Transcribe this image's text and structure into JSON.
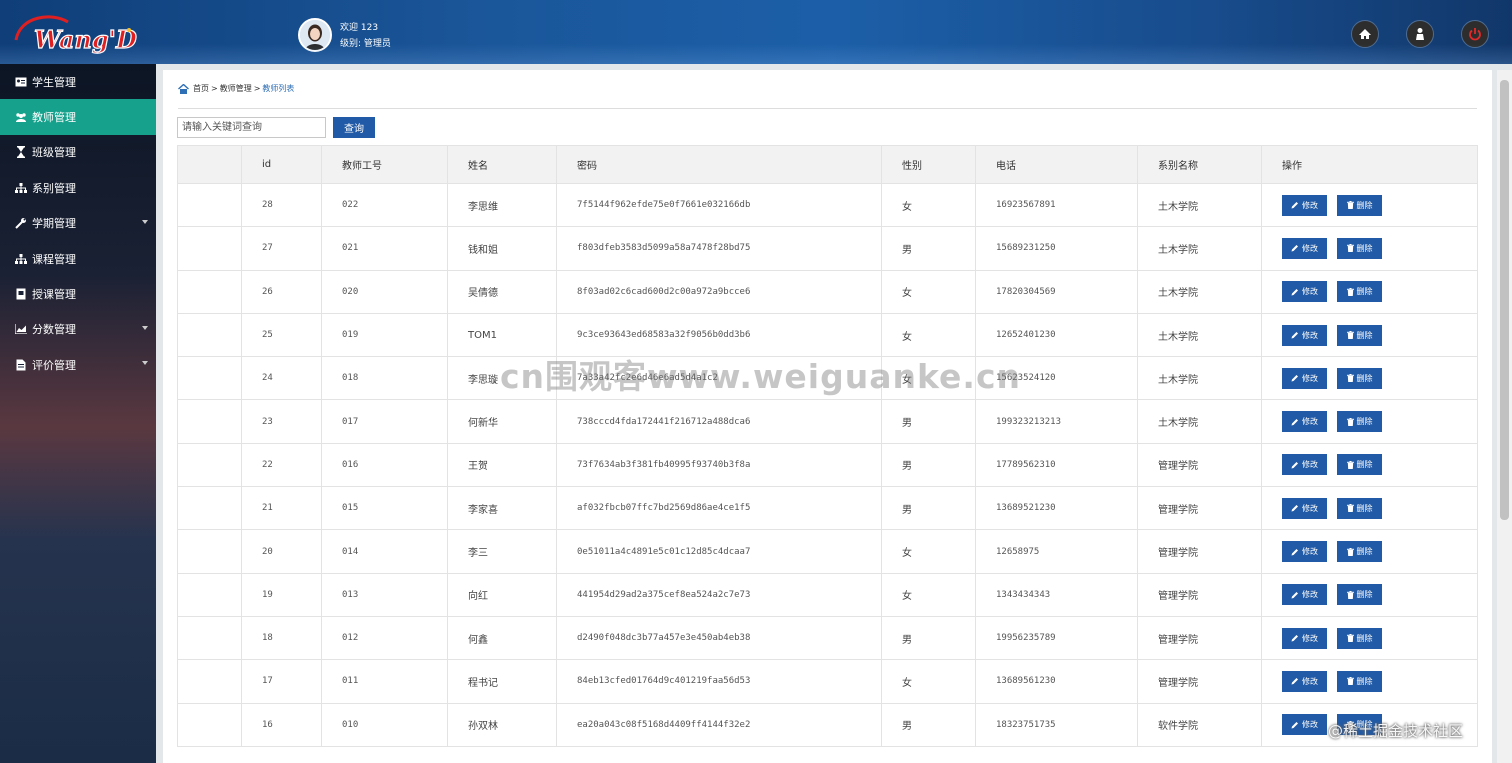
{
  "header": {
    "logo_text": "Wang'D",
    "welcome_label": "欢迎",
    "username": "123",
    "level_label": "级别:",
    "level_value": "管理员"
  },
  "header_buttons": [
    "home-icon",
    "user-icon",
    "power-icon"
  ],
  "sidebar": {
    "items": [
      {
        "label": "学生管理",
        "icon": "id-card-icon",
        "active": false,
        "has_submenu": false
      },
      {
        "label": "教师管理",
        "icon": "users-icon",
        "active": true,
        "has_submenu": false
      },
      {
        "label": "班级管理",
        "icon": "hourglass-icon",
        "active": false,
        "has_submenu": false
      },
      {
        "label": "系别管理",
        "icon": "sitemap-icon",
        "active": false,
        "has_submenu": false
      },
      {
        "label": "学期管理",
        "icon": "wrench-icon",
        "active": false,
        "has_submenu": true
      },
      {
        "label": "课程管理",
        "icon": "sitemap-icon",
        "active": false,
        "has_submenu": false
      },
      {
        "label": "授课管理",
        "icon": "book-icon",
        "active": false,
        "has_submenu": false
      },
      {
        "label": "分数管理",
        "icon": "chart-icon",
        "active": false,
        "has_submenu": true
      },
      {
        "label": "评价管理",
        "icon": "file-icon",
        "active": false,
        "has_submenu": true
      }
    ]
  },
  "breadcrumb": {
    "home": "首页",
    "section": "教师管理",
    "current": "教师列表"
  },
  "search": {
    "placeholder": "请输入关键词查询",
    "button_label": "查询"
  },
  "table": {
    "columns": [
      "",
      "id",
      "教师工号",
      "姓名",
      "密码",
      "性别",
      "电话",
      "系别名称",
      "操作"
    ],
    "edit_label": "修改",
    "delete_label": "删除",
    "rows": [
      {
        "id": "28",
        "no": "022",
        "name": "李思维",
        "pwd": "7f5144f962efde75e0f7661e032166db",
        "gender": "女",
        "phone": "16923567891",
        "dept": "土木学院"
      },
      {
        "id": "27",
        "no": "021",
        "name": "钱和姐",
        "pwd": "f803dfeb3583d5099a58a7478f28bd75",
        "gender": "男",
        "phone": "15689231250",
        "dept": "土木学院"
      },
      {
        "id": "26",
        "no": "020",
        "name": "吴倩德",
        "pwd": "8f03ad02c6cad600d2c00a972a9bcce6",
        "gender": "女",
        "phone": "17820304569",
        "dept": "土木学院"
      },
      {
        "id": "25",
        "no": "019",
        "name": "TOM1",
        "pwd": "9c3ce93643ed68583a32f9056b0dd3b6",
        "gender": "女",
        "phone": "12652401230",
        "dept": "土木学院"
      },
      {
        "id": "24",
        "no": "018",
        "name": "李思璇",
        "pwd": "7a33a42fc2e6d46e6ad5d4a1c2",
        "gender": "女",
        "phone": "15623524120",
        "dept": "土木学院"
      },
      {
        "id": "23",
        "no": "017",
        "name": "何新华",
        "pwd": "738cccd4fda172441f216712a488dca6",
        "gender": "男",
        "phone": "199323213213",
        "dept": "土木学院"
      },
      {
        "id": "22",
        "no": "016",
        "name": "王贺",
        "pwd": "73f7634ab3f381fb40995f93740b3f8a",
        "gender": "男",
        "phone": "17789562310",
        "dept": "管理学院"
      },
      {
        "id": "21",
        "no": "015",
        "name": "李家喜",
        "pwd": "af032fbcb07ffc7bd2569d86ae4ce1f5",
        "gender": "男",
        "phone": "13689521230",
        "dept": "管理学院"
      },
      {
        "id": "20",
        "no": "014",
        "name": "李三",
        "pwd": "0e51011a4c4891e5c01c12d85c4dcaa7",
        "gender": "女",
        "phone": "12658975",
        "dept": "管理学院"
      },
      {
        "id": "19",
        "no": "013",
        "name": "向红",
        "pwd": "441954d29ad2a375cef8ea524a2c7e73",
        "gender": "女",
        "phone": "1343434343",
        "dept": "管理学院"
      },
      {
        "id": "18",
        "no": "012",
        "name": "何鑫",
        "pwd": "d2490f048dc3b77a457e3e450ab4eb38",
        "gender": "男",
        "phone": "19956235789",
        "dept": "管理学院"
      },
      {
        "id": "17",
        "no": "011",
        "name": "程书记",
        "pwd": "84eb13cfed01764d9c401219faa56d53",
        "gender": "女",
        "phone": "13689561230",
        "dept": "管理学院"
      },
      {
        "id": "16",
        "no": "010",
        "name": "孙双林",
        "pwd": "ea20a043c08f5168d4409ff4144f32e2",
        "gender": "男",
        "phone": "18323751735",
        "dept": "软件学院"
      }
    ]
  },
  "watermarks": {
    "center": "cn围观客www.weiguanke.cn",
    "corner": "@稀土掘金技术社区"
  },
  "colors": {
    "accent": "#215aa6",
    "sidebar_active": "#15a18b",
    "header": "#1c5fa8"
  }
}
